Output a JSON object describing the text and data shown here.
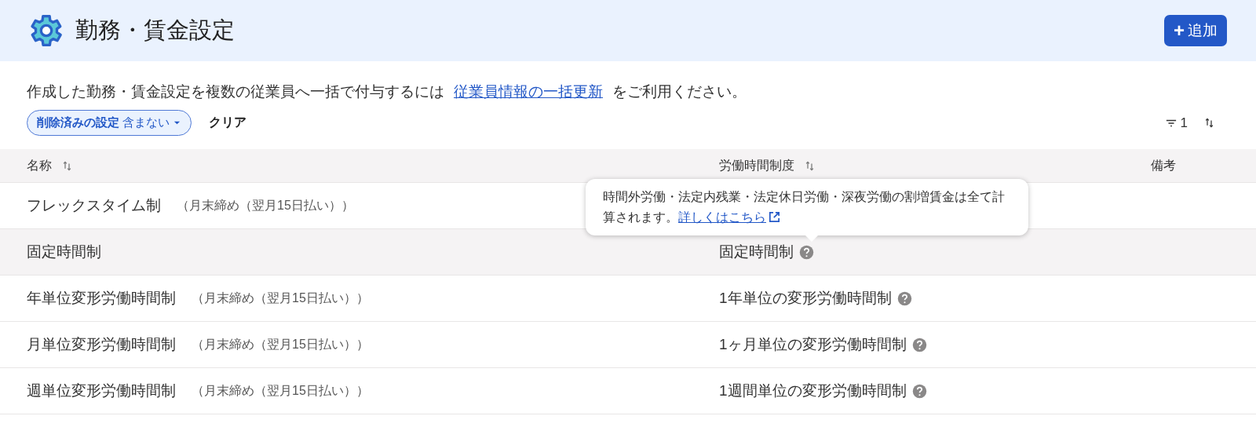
{
  "header": {
    "title": "勤務・賃金設定",
    "add_button": "追加",
    "add_icon": "+"
  },
  "info": {
    "before": "作成した勤務・賃金設定を複数の従業員へ一括で付与するには",
    "link": "従業員情報の一括更新",
    "after": "をご利用ください。"
  },
  "filter": {
    "chip_label": "削除済みの設定",
    "chip_value": "含まない",
    "clear": "クリア",
    "count": "1"
  },
  "table": {
    "columns": [
      {
        "label": "名称",
        "sortable": true
      },
      {
        "label": "労働時間制度",
        "sortable": true
      },
      {
        "label": "備考",
        "sortable": false
      }
    ],
    "rows": [
      {
        "name": "フレックスタイム制",
        "note": "（月末締め（翌月15日払い））",
        "hovered": false
      },
      {
        "name": "固定時間制",
        "system": "固定時間制",
        "hovered": true,
        "tooltip": {
          "text": "時間外労働・法定内残業・法定休日労働・深夜労働の割増賃金は全て計算されます。",
          "link": "詳しくはこちら"
        }
      },
      {
        "name": "年単位変形労働時間制",
        "note": "（月末締め（翌月15日払い））",
        "system": "1年単位の変形労働時間制",
        "hovered": false
      },
      {
        "name": "月単位変形労働時間制",
        "note": "（月末締め（翌月15日払い））",
        "system": "1ヶ月単位の変形労働時間制",
        "hovered": false
      },
      {
        "name": "週単位変形労働時間制",
        "note": "（月末締め（翌月15日払い））",
        "system": "1週間単位の変形労働時間制",
        "hovered": false
      }
    ]
  }
}
